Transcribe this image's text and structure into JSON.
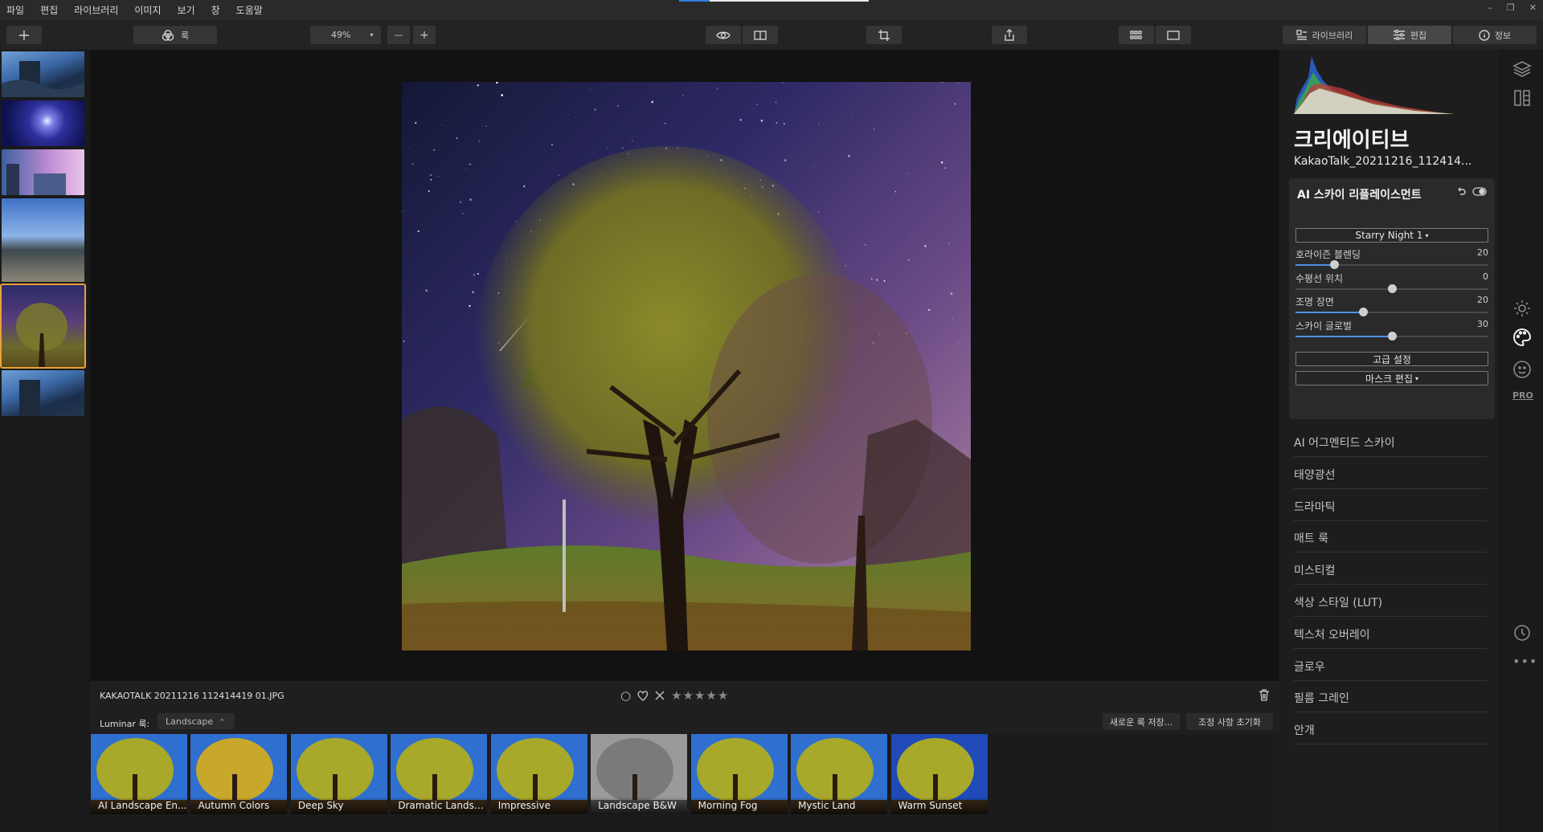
{
  "menu": [
    "파일",
    "편집",
    "라이브러리",
    "이미지",
    "보기",
    "창",
    "도움말"
  ],
  "load_progress": 0.16,
  "window_controls": {
    "minimize": "–",
    "restore": "❐",
    "close": "✕"
  },
  "toolbar": {
    "add_icon": "plus-icon",
    "looks_label": "룩",
    "zoom_value": "49%",
    "zoom_out": "—",
    "zoom_in": "+",
    "tabs": [
      {
        "label": "라이브러리",
        "icon": "library-icon"
      },
      {
        "label": "편집",
        "icon": "sliders-icon",
        "active": true
      },
      {
        "label": "정보",
        "icon": "info-icon"
      }
    ]
  },
  "filmstrip": {
    "selected_index": 4
  },
  "photo": {
    "filename": "KAKAOTALK 20211216 112414419 01.JPG"
  },
  "rating": {
    "color_label": "○",
    "stars": "★★★★★",
    "favorite_icon": "heart-icon",
    "reject_icon": "x-icon"
  },
  "looks": {
    "label": "Luminar 룩:",
    "category": "Landscape",
    "save_button": "새로운 룩 저장...",
    "reset_button": "조정 사항 초기화",
    "items": [
      "AI Landscape En...",
      "Autumn Colors",
      "Deep Sky",
      "Dramatic Landsc...",
      "Impressive",
      "Landscape B&W",
      "Morning Fog",
      "Mystic Land",
      "Warm Sunset"
    ]
  },
  "panel": {
    "title": "크리에이티브",
    "file": "KakaoTalk_20211216_112414...",
    "tool": {
      "title": "AI 스카이 리플레이스먼트",
      "sky_select": "Starry Night 1",
      "sliders": [
        {
          "label": "호라이즌 블렌딩",
          "value": "20",
          "level": 0.2,
          "origin": 0
        },
        {
          "label": "수평선 위치",
          "value": "0",
          "level": 0.5,
          "origin": 0.5
        },
        {
          "label": "조명 장면",
          "value": "20",
          "level": 0.35,
          "origin": 0
        },
        {
          "label": "스카이 글로벌",
          "value": "30",
          "level": 0.5,
          "origin": 0
        }
      ],
      "advanced": "고급 설정",
      "mask_edit": "마스크 편집"
    },
    "sections": [
      "AI 어그멘티드 스카이",
      "태양광선",
      "드라마틱",
      "매트 룩",
      "미스티컬",
      "색상 스타일 (LUT)",
      "텍스처 오버레이",
      "글로우",
      "필름 그레인",
      "안개"
    ]
  },
  "side_icons": {
    "pro_label": "PRO"
  },
  "colors": {
    "accent": "#4f8fe6",
    "selection": "#e8a23a"
  }
}
